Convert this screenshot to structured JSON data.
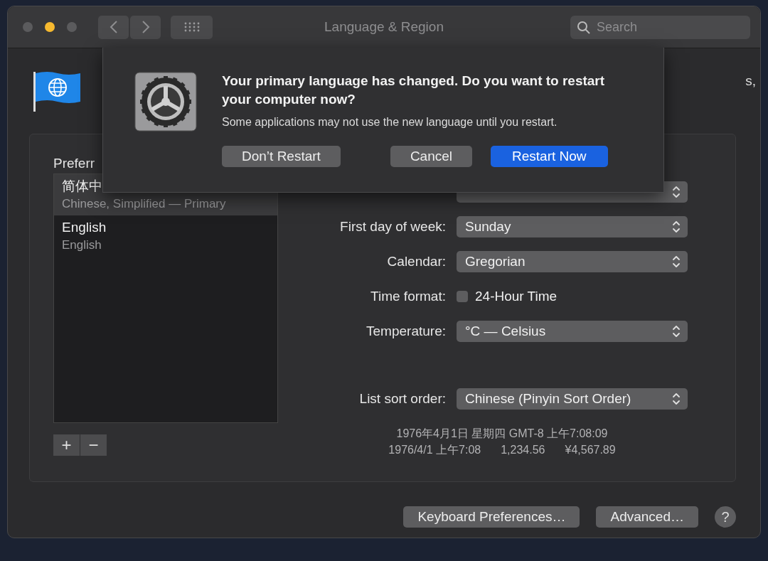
{
  "window": {
    "title": "Language & Region",
    "traffic_lights": [
      {
        "color": "#5b5b5d"
      },
      {
        "color": "#f6b92f"
      },
      {
        "color": "#5b5b5d"
      }
    ],
    "search": {
      "placeholder": "Search"
    }
  },
  "header": {
    "description": "s,"
  },
  "panel": {
    "title": "Preferr",
    "languages": [
      {
        "name": "简体中",
        "subtitle": "Chinese, Simplified — Primary",
        "selected": true
      },
      {
        "name": "English",
        "subtitle": "English",
        "selected": false
      }
    ],
    "list_buttons": [
      "+",
      "−"
    ]
  },
  "settings": [
    {
      "kind": "popup"
    },
    {
      "kind": "popup",
      "label": "First day of week:",
      "value": "Sunday"
    },
    {
      "kind": "popup",
      "label": "Calendar:",
      "value": "Gregorian"
    },
    {
      "kind": "checkbox",
      "label": "Time format:",
      "value": "24-Hour Time",
      "checked": false
    },
    {
      "kind": "popup",
      "label": "Temperature:",
      "value": "°C — Celsius"
    },
    {
      "kind": "popup",
      "label": "List sort order:",
      "value": "Chinese (Pinyin Sort Order)"
    }
  ],
  "samples": [
    [
      "1976年4月1日 星期四 GMT-8 上午7:08:09"
    ],
    [
      "1976/4/1 上午7:08",
      "1,234.56",
      "¥4,567.89"
    ]
  ],
  "footer": {
    "buttons": [
      "Keyboard Preferences…",
      "Advanced…"
    ],
    "help": "?"
  },
  "dialog": {
    "title": "Your primary language has changed. Do you want to restart your computer now?",
    "message": "Some applications may not use the new language until you restart.",
    "buttons": [
      {
        "label": "Don’t Restart",
        "default": false
      },
      {
        "label": "Cancel",
        "default": false
      },
      {
        "label": "Restart Now",
        "default": true
      }
    ]
  }
}
